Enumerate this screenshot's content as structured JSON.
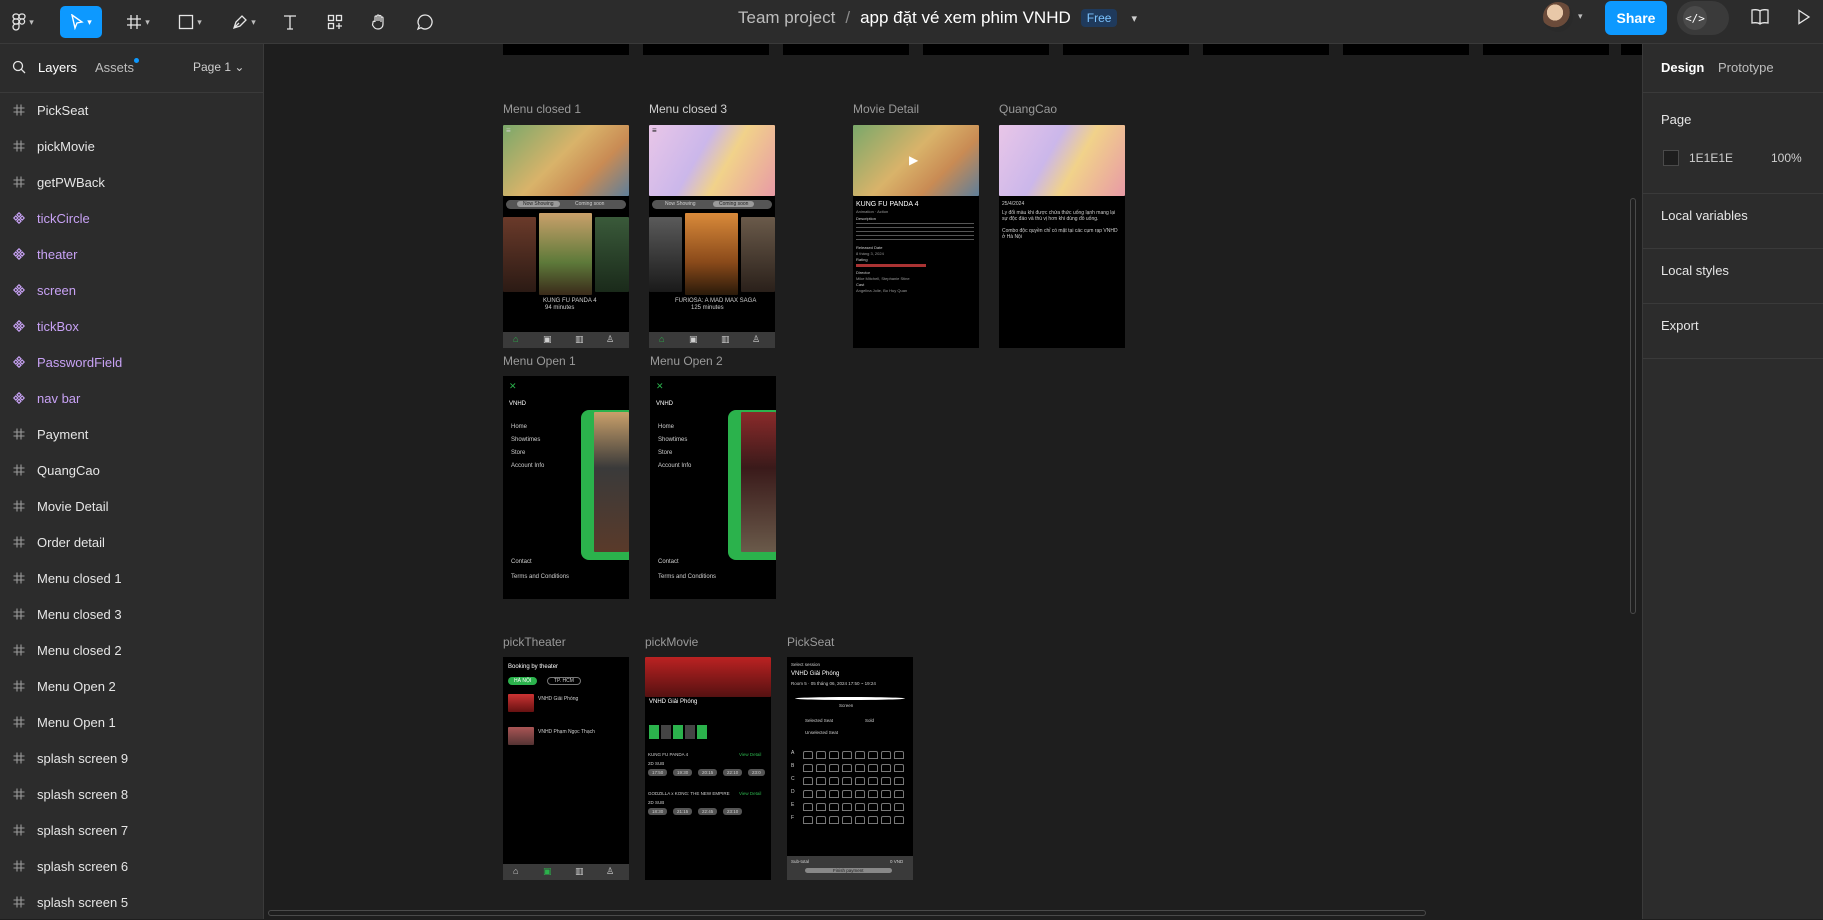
{
  "toolbar": {
    "team": "Team project",
    "separator": "/",
    "file_name": "app đặt vé xem phim VNHD",
    "plan_badge": "Free",
    "share_label": "Share",
    "devmode_label": "</>"
  },
  "left_panel": {
    "tab_layers": "Layers",
    "tab_assets": "Assets",
    "page_selector": "Page 1 ⌄",
    "layers": [
      {
        "name": "PickSeat",
        "kind": "frame"
      },
      {
        "name": "pickMovie",
        "kind": "frame"
      },
      {
        "name": "getPWBack",
        "kind": "frame"
      },
      {
        "name": "tickCircle",
        "kind": "component"
      },
      {
        "name": "theater",
        "kind": "component"
      },
      {
        "name": "screen",
        "kind": "component"
      },
      {
        "name": "tickBox",
        "kind": "component"
      },
      {
        "name": "PasswordField",
        "kind": "component"
      },
      {
        "name": "nav bar",
        "kind": "component"
      },
      {
        "name": "Payment",
        "kind": "frame"
      },
      {
        "name": "QuangCao",
        "kind": "frame"
      },
      {
        "name": "Movie Detail",
        "kind": "frame"
      },
      {
        "name": "Order detail",
        "kind": "frame"
      },
      {
        "name": "Menu closed 1",
        "kind": "frame"
      },
      {
        "name": "Menu closed 3",
        "kind": "frame"
      },
      {
        "name": "Menu closed 2",
        "kind": "frame"
      },
      {
        "name": "Menu Open 2",
        "kind": "frame"
      },
      {
        "name": "Menu Open 1",
        "kind": "frame"
      },
      {
        "name": "splash screen 9",
        "kind": "frame"
      },
      {
        "name": "splash screen 8",
        "kind": "frame"
      },
      {
        "name": "splash screen 7",
        "kind": "frame"
      },
      {
        "name": "splash screen 6",
        "kind": "frame"
      },
      {
        "name": "splash screen 5",
        "kind": "frame"
      }
    ]
  },
  "canvas": {
    "frames": {
      "menu_closed_1": "Menu closed 1",
      "menu_closed_3": "Menu closed 3",
      "movie_detail": "Movie Detail",
      "quangcao": "QuangCao",
      "menu_open_1": "Menu Open 1",
      "menu_open_2": "Menu Open 2",
      "pick_theater": "pickTheater",
      "pick_movie": "pickMovie",
      "pick_seat": "PickSeat"
    },
    "content": {
      "now_showing": "Now Showing",
      "coming_soon": "Coming soon",
      "kfp_title": "KUNG FU PANDA 4",
      "kfp_runtime": "94 minutes",
      "furiosa_title": "FURIOSA: A MAD MAX SAGA",
      "furiosa_runtime": "125 minutes",
      "detail_title": "KUNG FU PANDA 4",
      "detail_genre": "Animation · Action",
      "detail_description": "Description",
      "detail_release": "Released Date",
      "detail_date": "8 tháng 3, 2024",
      "detail_rating": "Rating",
      "detail_director": "Director",
      "detail_director_name": "Mike Mitchell, Stephanie Stine",
      "detail_cast": "Cast",
      "detail_cast_names": "Angelina Jolie, Bo Huy Quan",
      "qc_date": "25/4/2024",
      "qc_text1": "Ly đổi màu khi được chứa thức uống lạnh mang lại sự độc đáo và thú vị hơn khi dùng đồ uống.",
      "qc_text2": "Combo độc quyền chỉ có mặt tại các cụm rạp VNHD ở Hà Nội",
      "brand": "VNHD",
      "menu_home": "Home",
      "menu_showtimes": "Showtimes",
      "menu_store": "Store",
      "menu_account": "Account Info",
      "menu_contact": "Contact",
      "menu_terms": "Terms and Conditions",
      "theater_heading": "Booking by theater",
      "theater_chip1": "HÀ NỘI",
      "theater_chip2": "TP. HCM",
      "theater_1": "VNHD Giải Phóng",
      "theater_2": "VNHD Phạm Ngọc Thạch",
      "pm_theater": "VNHD Giải Phóng",
      "pm_movie1": "KUNG FU PANDA 4",
      "pm_format": "2D SUB",
      "pm_movie2": "GODZILLA x KONG: THE NEW EMPIRE",
      "pm_view_detail": "View Detail",
      "pm_times1": [
        "17:50",
        "19:30",
        "20:15",
        "22:10",
        "23:0"
      ],
      "pm_times2": [
        "18:30",
        "21:15",
        "22:45",
        "23:10"
      ],
      "ps_select": "Select session",
      "ps_theater": "VNHD Giải Phóng",
      "ps_room": "Room 5 · 05 tháng 06, 2024 17:50 ~ 19:24",
      "ps_screen": "Screen",
      "ps_selected": "Selected Seat",
      "ps_sold": "Sold",
      "ps_unselected": "Unselected Seat",
      "ps_rows": [
        "A",
        "B",
        "C",
        "D",
        "E",
        "F"
      ],
      "ps_subtotal": "Sub-total",
      "ps_total_value": "0 VND",
      "ps_finish": "Finish payment"
    }
  },
  "right_panel": {
    "tab_design": "Design",
    "tab_prototype": "Prototype",
    "page_heading": "Page",
    "page_color": "1E1E1E",
    "page_opacity": "100%",
    "local_variables": "Local variables",
    "local_styles": "Local styles",
    "export": "Export"
  },
  "colors": {
    "accent": "#0D99FF",
    "canvas": "#1E1E1E",
    "panel": "#2C2C2C",
    "component": "#C8A2F5",
    "app_green": "#2BB24C"
  }
}
